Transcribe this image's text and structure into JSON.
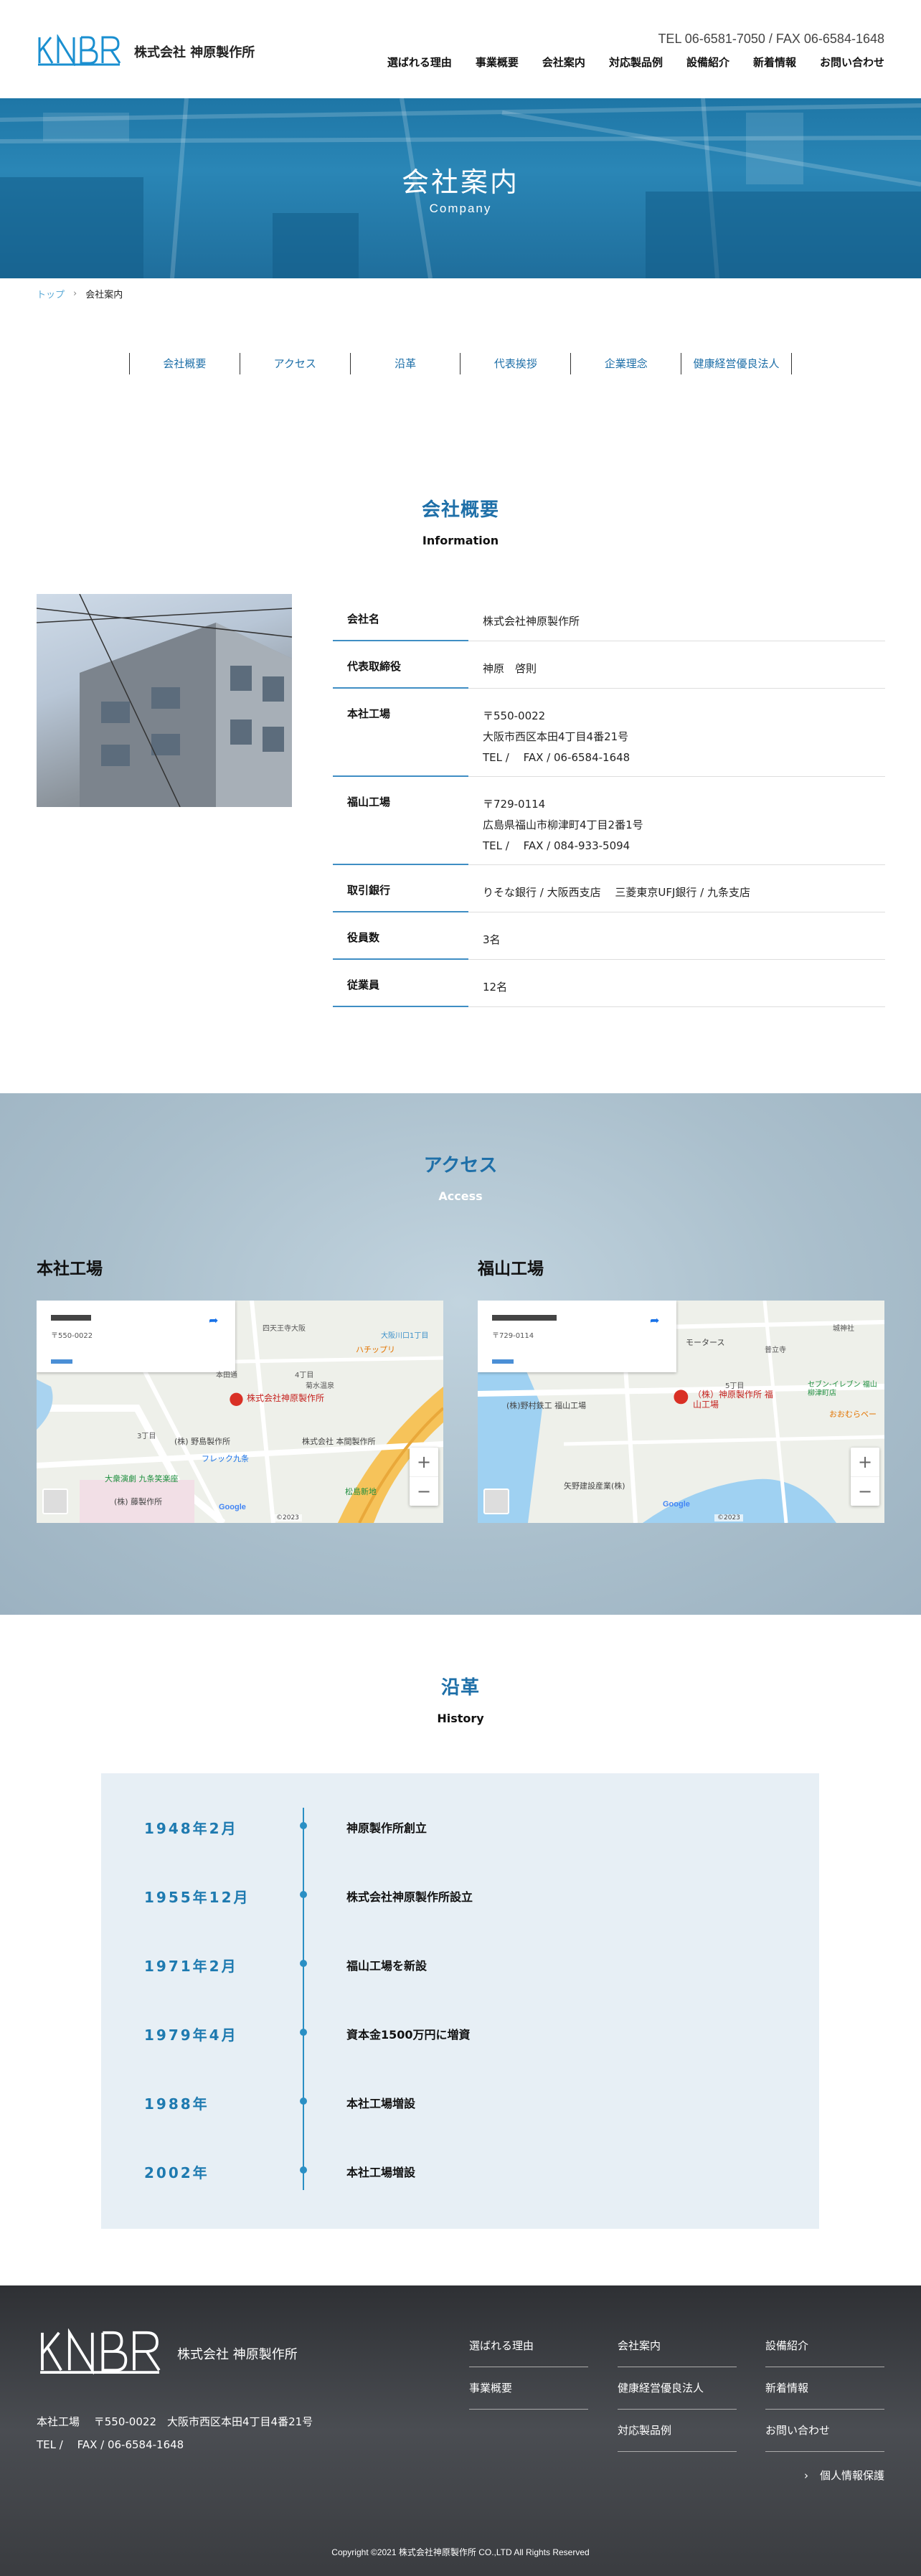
{
  "header": {
    "company_name": "株式会社 神原製作所",
    "contact": "TEL 06-6581-7050 / FAX 06-6584-1648",
    "nav": [
      "選ばれる理由",
      "事業概要",
      "会社案内",
      "対応製品例",
      "設備紹介",
      "新着情報",
      "お問い合わせ"
    ]
  },
  "hero": {
    "title": "会社案内",
    "subtitle": "Company"
  },
  "breadcrumb": {
    "home": "トップ",
    "current": "会社案内"
  },
  "subnav": [
    "会社概要",
    "アクセス",
    "沿革",
    "代表挨拶",
    "企業理念",
    "健康経営優良法人"
  ],
  "overview": {
    "title": "会社概要",
    "subtitle": "Information",
    "rows": [
      {
        "label": "会社名",
        "lines": [
          "株式会社神原製作所"
        ]
      },
      {
        "label": "代表取締役",
        "lines": [
          "神原　啓則"
        ]
      },
      {
        "label": "本社工場",
        "lines": [
          "〒550-0022",
          "大阪市西区本田4丁目4番21号",
          "TEL /　 FAX / 06-6584-1648"
        ]
      },
      {
        "label": "福山工場",
        "lines": [
          "〒729-0114",
          "広島県福山市柳津町4丁目2番1号",
          "TEL /　 FAX / 084-933-5094"
        ]
      },
      {
        "label": "取引銀行",
        "lines": [
          "りそな銀行 / 大阪西支店　 三菱東京UFJ銀行 / 九条支店"
        ]
      },
      {
        "label": "役員数",
        "lines": [
          "3名"
        ]
      },
      {
        "label": "従業員",
        "lines": [
          "12名"
        ]
      }
    ]
  },
  "access": {
    "title": "アクセス",
    "subtitle": "Access",
    "maps": [
      {
        "name": "本社工場",
        "card_postal": "〒550-0022",
        "pin_label": "株式会社神原製作所",
        "labels": [
          "本田通",
          "4丁目",
          "菊水温泉",
          "ハチップリ",
          "(株) 野島製作所",
          "株式会社 本間製作所",
          "フレック九条",
          "大衆演劇 九条笑楽座",
          "(株) 藤製作所",
          "松島新地",
          "3丁目",
          "四天王寺大阪",
          "大阪川口1丁目"
        ],
        "zoom": [
          "+",
          "−"
        ],
        "footer": "©2023"
      },
      {
        "name": "福山工場",
        "card_postal": "〒729-0114",
        "pin_label": "（株）神原製作所 福山工場",
        "labels": [
          "モータース",
          "城神社",
          "普立寺",
          "5丁目",
          "セブン-イレブン 福山柳津町店",
          "おおむらベー",
          "(株)野村鉄工 福山工場",
          "矢野建設産業(株)"
        ],
        "zoom": [
          "+",
          "−"
        ],
        "footer": "©2023"
      }
    ]
  },
  "history": {
    "title": "沿革",
    "subtitle": "History",
    "rows": [
      {
        "year": "1948年2月",
        "event": "神原製作所創立"
      },
      {
        "year": "1955年12月",
        "event": "株式会社神原製作所設立"
      },
      {
        "year": "1971年2月",
        "event": "福山工場を新設"
      },
      {
        "year": "1979年4月",
        "event": "資本金1500万円に増資"
      },
      {
        "year": "1988年",
        "event": "本社工場増設"
      },
      {
        "year": "2002年",
        "event": "本社工場増設"
      }
    ]
  },
  "footer": {
    "company_name": "株式会社 神原製作所",
    "address": "本社工場　 〒550-0022　大阪市西区本田4丁目4番21号",
    "tel": "TEL /　 FAX / 06-6584-1648",
    "nav_col1": [
      "選ばれる理由",
      "事業概要"
    ],
    "nav_col2": [
      "会社案内",
      "健康経営優良法人",
      "対応製品例"
    ],
    "nav_col3": [
      "設備紹介",
      "新着情報",
      "お問い合わせ"
    ],
    "privacy": "個人情報保護",
    "copyright": "Copyright ©2021 株式会社神原製作所 CO.,LTD All Rights Reserved"
  },
  "colors": {
    "accent": "#1e6fa8",
    "hero": "#1e76a6",
    "footer": "#3a3c40",
    "history_bg": "#e7eff5"
  }
}
